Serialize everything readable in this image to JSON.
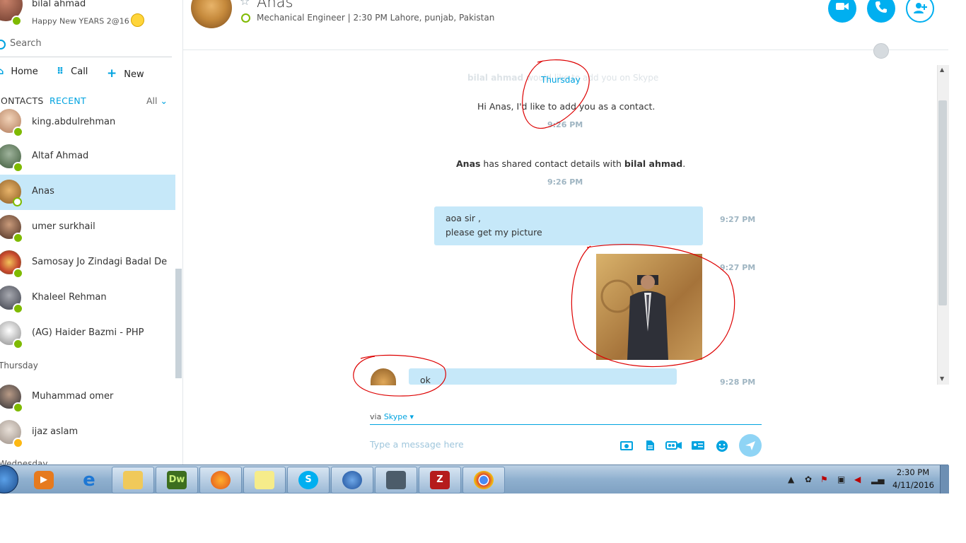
{
  "profile": {
    "name": "bilal ahmad",
    "mood": "Happy New YEARS 2@16"
  },
  "search": {
    "placeholder": "Search"
  },
  "nav": {
    "home": "Home",
    "call": "Call",
    "new": "New"
  },
  "tabs": {
    "contacts": "CONTACTS",
    "recent": "RECENT",
    "filter": "All"
  },
  "contacts": [
    {
      "name": "king.abdulrehman",
      "status": "online"
    },
    {
      "name": "Altaf Ahmad",
      "status": "online"
    },
    {
      "name": "Anas",
      "status": "away",
      "active": true
    },
    {
      "name": "umer surkhail",
      "status": "online"
    },
    {
      "name": "Samosay Jo Zindagi Badal De",
      "status": "online"
    },
    {
      "name": "Khaleel Rehman",
      "status": "online"
    },
    {
      "name": "(AG) Haider Bazmi - PHP",
      "status": "online"
    }
  ],
  "groups": {
    "thursday": "Thursday",
    "wednesday": "Wednesday"
  },
  "contacts_thursday": [
    {
      "name": "Muhammad omer",
      "status": "online"
    },
    {
      "name": "ijaz aslam",
      "status": "idle"
    }
  ],
  "header": {
    "name": "Anas",
    "subtitle": "Mechanical Engineer  |  2:30 PM Lahore, punjab, Pakistan"
  },
  "chat": {
    "faded_line_name": "bilal ahmad",
    "faded_line_rest": "would like to add you on Skype",
    "day_label": "Thursday",
    "request_text": "Hi Anas, I'd like to add you as a contact.",
    "request_time": "9:26 PM",
    "shared_from": "Anas",
    "shared_mid": " has shared contact details with ",
    "shared_to": "bilal ahmad",
    "shared_end": ".",
    "shared_time": "9:26 PM",
    "msg1_line1": "aoa sir ,",
    "msg1_line2": "please get my picture",
    "msg1_time": "9:27 PM",
    "photo_time": "9:27 PM",
    "msg2_text": "ok",
    "msg2_time": "9:28 PM"
  },
  "composer": {
    "via": "via",
    "via_service": "Skype",
    "placeholder": "Type a message here"
  },
  "taskbar": {
    "apps": [
      "media-player",
      "internet-explorer",
      "file-explorer",
      "dreamweaver",
      "firefox",
      "sticky-notes",
      "skype",
      "thunderbird",
      "remote-desktop",
      "filezilla",
      "chrome"
    ],
    "dw_label": "Dw",
    "time": "2:30 PM",
    "date": "4/11/2016"
  },
  "colors": {
    "accent": "#00aff0",
    "selected": "#c6e8f9",
    "online": "#7fba00",
    "idle": "#fdb813"
  }
}
